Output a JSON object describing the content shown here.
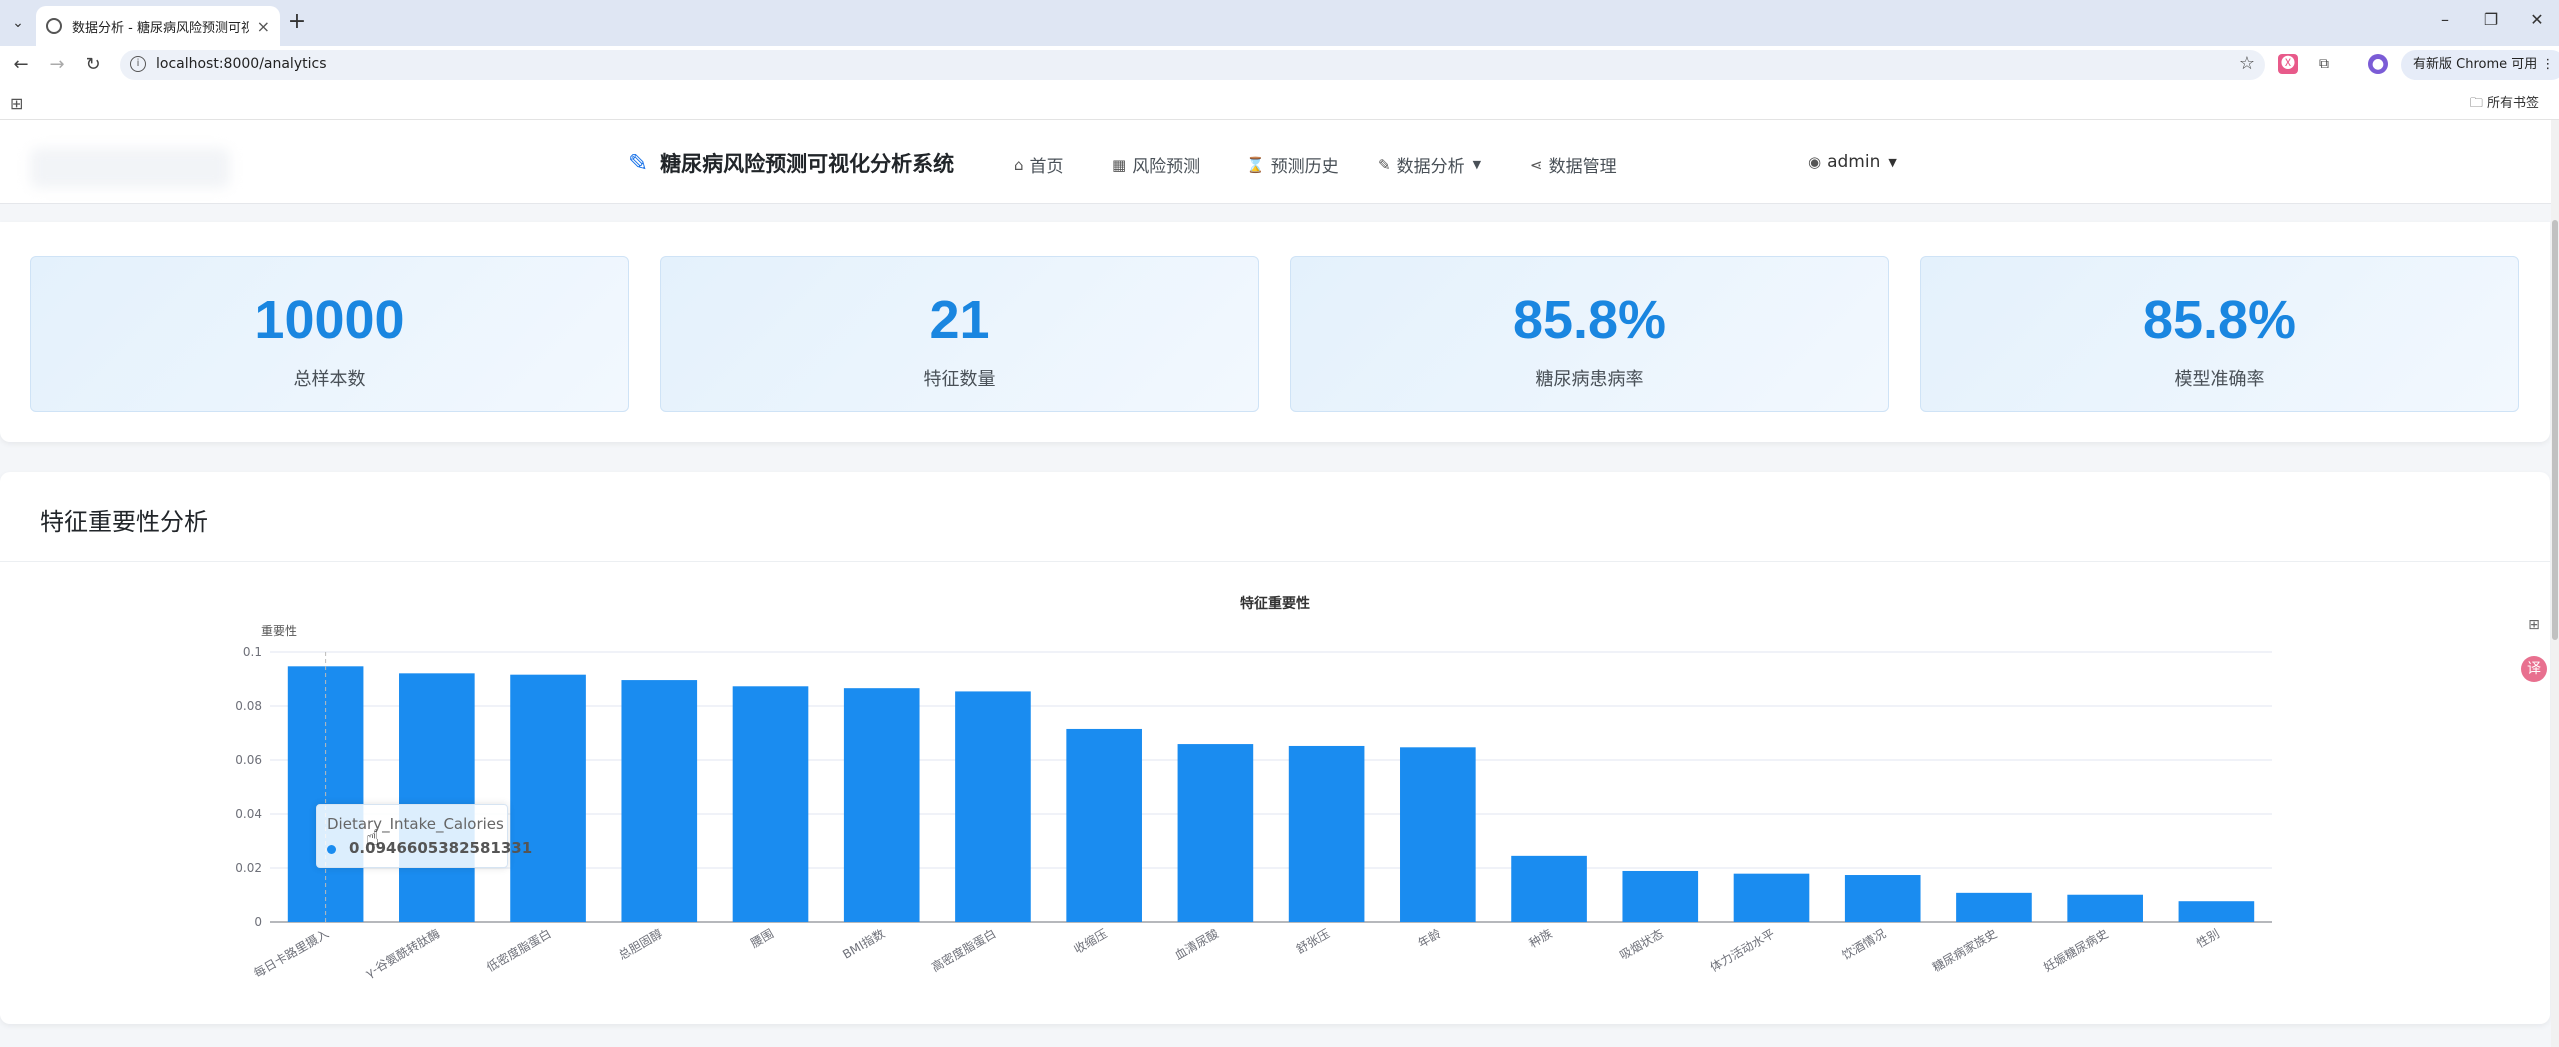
{
  "browser": {
    "tab_title": "数据分析 - 糖尿病风险预测可视化分析系统",
    "url": "localhost:8000/analytics",
    "update_label": "有新版 Chrome 可用",
    "all_bookmarks": "所有书签"
  },
  "nav": {
    "brand": "糖尿病风险预测可视化分析系统",
    "items": [
      {
        "label": "首页",
        "icon": "home-icon"
      },
      {
        "label": "风险预测",
        "icon": "calculator-icon"
      },
      {
        "label": "预测历史",
        "icon": "clock-icon"
      },
      {
        "label": "数据分析",
        "icon": "edit-icon"
      },
      {
        "label": "数据管理",
        "icon": "share-icon"
      }
    ],
    "user": "admin"
  },
  "stats": [
    {
      "value": "10000",
      "label": "总样本数"
    },
    {
      "value": "21",
      "label": "特征数量"
    },
    {
      "value": "85.8%",
      "label": "糖尿病患病率"
    },
    {
      "value": "85.8%",
      "label": "模型准确率"
    }
  ],
  "feature_section": {
    "title": "特征重要性分析"
  },
  "tooltip": {
    "name": "Dietary_Intake_Calories",
    "value": "0.0946605382581331"
  },
  "colors": {
    "bar": "#1a8cf0",
    "stat_value": "#1a86e0",
    "accent": "#1a73e8"
  },
  "chart_data": {
    "type": "bar",
    "title": "特征重要性",
    "ylabel": "重要性",
    "xlabel": "",
    "ylim": [
      0,
      0.1
    ],
    "yticks": [
      "0",
      "0.02",
      "0.04",
      "0.06",
      "0.08",
      "0.1"
    ],
    "grid": true,
    "categories": [
      "每日卡路里摄入",
      "γ-谷氨酰转肽酶",
      "低密度脂蛋白",
      "总胆固醇",
      "腰围",
      "BMI指数",
      "高密度脂蛋白",
      "收缩压",
      "血清尿酸",
      "舒张压",
      "年龄",
      "种族",
      "吸烟状态",
      "体力活动水平",
      "饮酒情况",
      "糖尿病家族史",
      "妊娠糖尿病史",
      "性别"
    ],
    "values": [
      0.0947,
      0.0921,
      0.0916,
      0.0896,
      0.0873,
      0.0866,
      0.0854,
      0.0715,
      0.0659,
      0.0652,
      0.0647,
      0.0245,
      0.0189,
      0.0179,
      0.0174,
      0.0108,
      0.0101,
      0.0077
    ]
  }
}
